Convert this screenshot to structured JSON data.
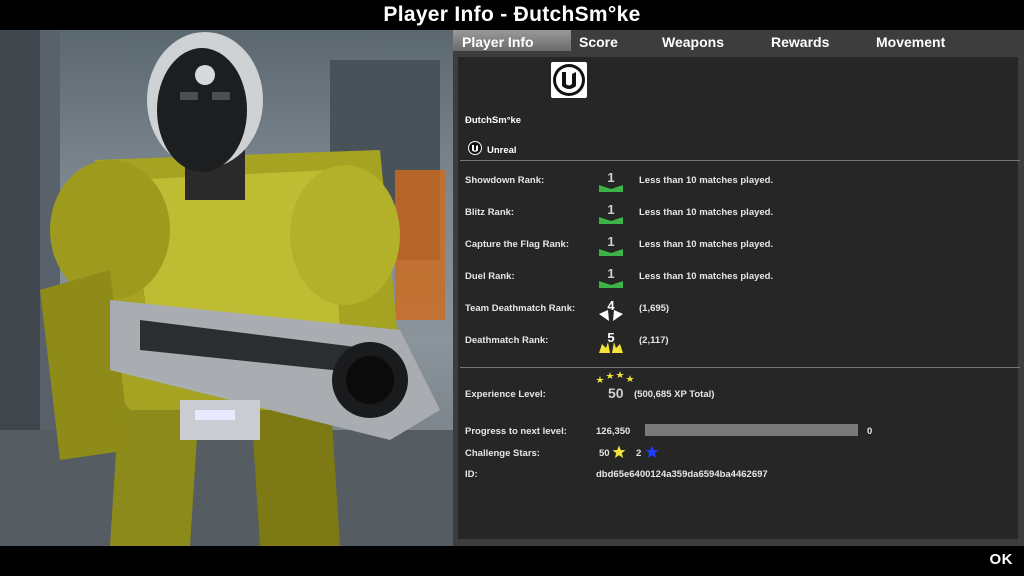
{
  "window": {
    "title": "Player Info - ÐutchSm°ke",
    "ok_label": "OK"
  },
  "tabs": [
    {
      "label": "Player Info",
      "active": true
    },
    {
      "label": "Score",
      "active": false
    },
    {
      "label": "Weapons",
      "active": false
    },
    {
      "label": "Rewards",
      "active": false
    },
    {
      "label": "Movement",
      "active": false
    }
  ],
  "player": {
    "name": "ÐutchSm°ke",
    "logo_icon": "unreal-logo-icon",
    "team_label": "Unreal"
  },
  "ranks": [
    {
      "label": "Showdown Rank:",
      "value": "1",
      "note": "Less than 10 matches played.",
      "badge_color": "#3db34a"
    },
    {
      "label": "Blitz Rank:",
      "value": "1",
      "note": "Less than 10 matches played.",
      "badge_color": "#3db34a"
    },
    {
      "label": "Capture the Flag Rank:",
      "value": "1",
      "note": "Less than 10 matches played.",
      "badge_color": "#3db34a"
    },
    {
      "label": "Duel Rank:",
      "value": "1",
      "note": "Less than 10 matches played.",
      "badge_color": "#3db34a"
    },
    {
      "label": "Team Deathmatch Rank:",
      "value": "4",
      "note": "(1,695)",
      "badge_color": "#ffffff"
    },
    {
      "label": "Deathmatch Rank:",
      "value": "5",
      "note": "(2,117)",
      "badge_color": "#f2e23a"
    }
  ],
  "experience": {
    "label": "Experience Level:",
    "level": "50",
    "total": "(500,685 XP Total)"
  },
  "progress": {
    "label": "Progress to next level:",
    "current": "126,350",
    "remaining": "0",
    "fraction": 1.0
  },
  "challenge": {
    "label": "Challenge Stars:",
    "gold_count": "50",
    "blue_count": "2",
    "gold_color": "#f2e23a",
    "blue_color": "#1e3cff"
  },
  "id": {
    "label": "ID:",
    "value": "dbd65e6400124a359da6594ba4462697"
  },
  "colors": {
    "panel_bg": "#262626",
    "frame_bg": "#3d3d3d",
    "rank_green": "#3db34a"
  }
}
